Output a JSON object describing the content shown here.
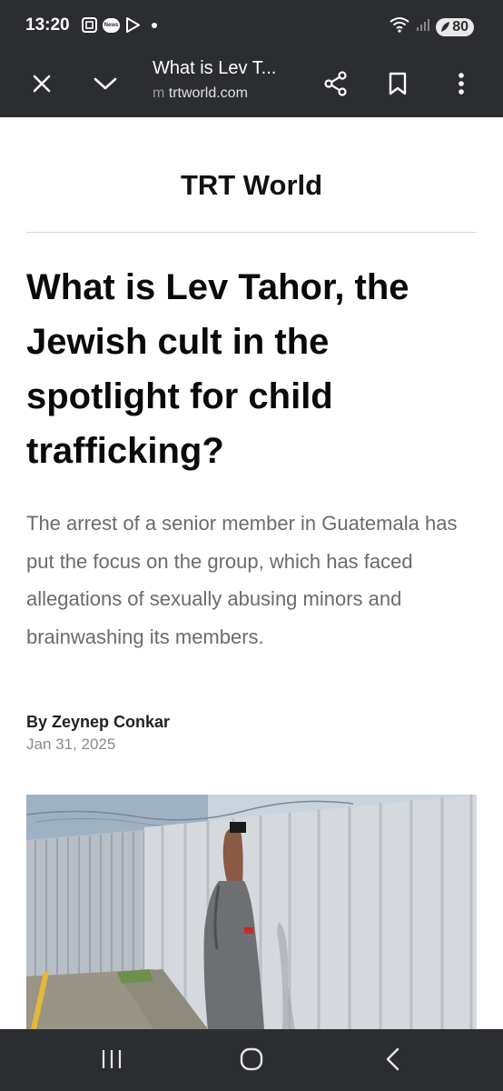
{
  "status_bar": {
    "time": "13:20",
    "news_badge": "News",
    "battery": "80",
    "icons": [
      "screenshot-icon",
      "news-icon",
      "play-store-icon",
      "notification-dot-icon",
      "wifi-icon",
      "signal-icon",
      "battery-icon"
    ]
  },
  "toolbar": {
    "title": "What is Lev T...",
    "url_prefix": "m",
    "url": "trtworld.com",
    "icons": [
      "close-icon",
      "chevron-down-icon",
      "share-icon",
      "bookmark-icon",
      "more-vert-icon"
    ]
  },
  "article": {
    "site_name": "TRT World",
    "headline": "What is Lev Tahor, the Jewish cult in the spotlight for child trafficking?",
    "summary": "The arrest of a senior member in Guatemala has put the focus on the group, which has faced allegations of sexually abusing minors and brainwashing its members.",
    "byline": "By Zeynep Conkar",
    "date": "Jan 31, 2025"
  },
  "nav_bar": {
    "icons": [
      "recent-apps-icon",
      "home-icon",
      "back-icon"
    ]
  },
  "colors": {
    "chrome_bg": "#2b2d30",
    "headline": "#0a0a0a",
    "summary": "#6b6b6b",
    "date": "#8a8a8a"
  }
}
